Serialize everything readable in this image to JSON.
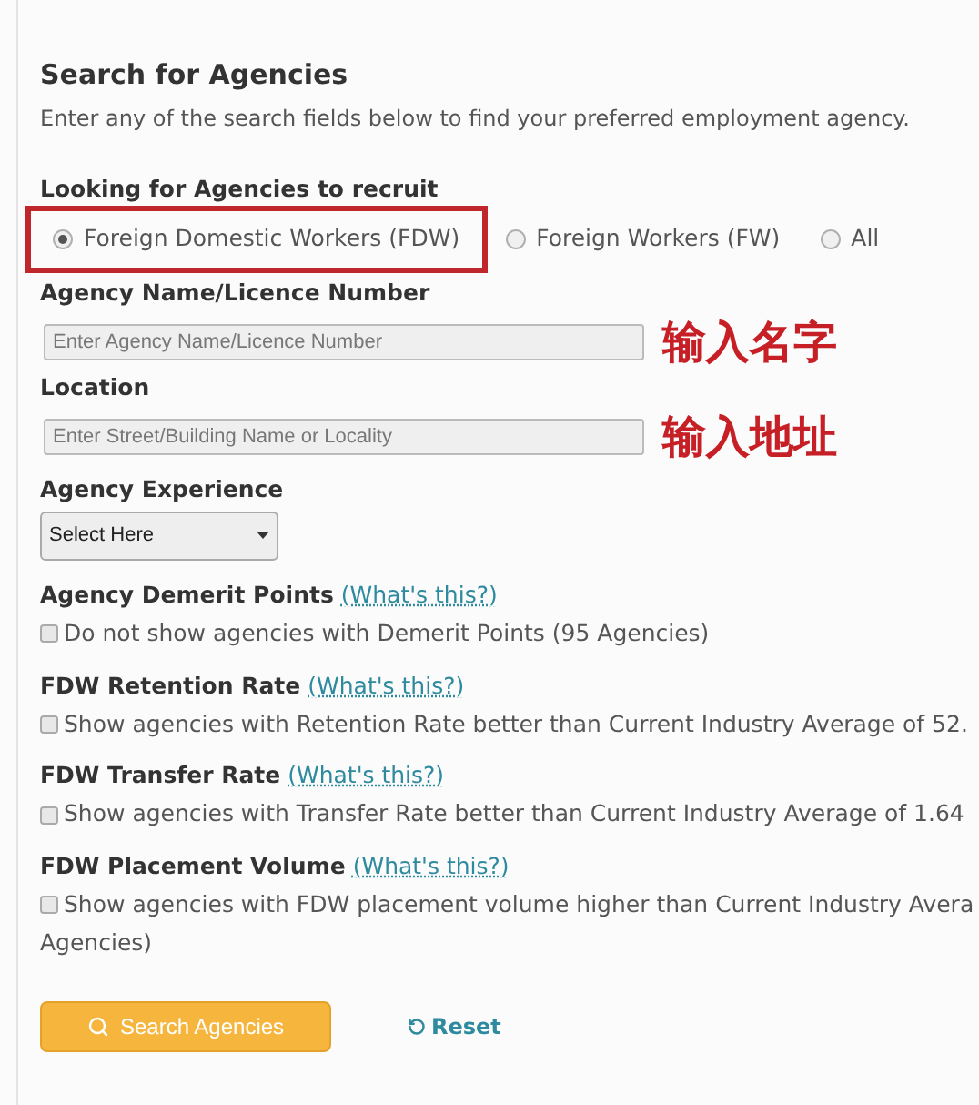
{
  "heading": "Search for Agencies",
  "intro": "Enter any of the search fields below to find your preferred employment agency.",
  "recruit": {
    "label": "Looking for Agencies to recruit",
    "options": [
      {
        "label": "Foreign Domestic Workers (FDW)",
        "selected": true,
        "highlighted": true
      },
      {
        "label": "Foreign Workers (FW)",
        "selected": false,
        "highlighted": false
      },
      {
        "label": "All",
        "selected": false,
        "highlighted": false
      }
    ]
  },
  "fields": [
    {
      "label": "Agency Name/Licence Number",
      "placeholder": "Enter Agency Name/Licence Number",
      "annotation": "输入名字"
    },
    {
      "label": "Location",
      "placeholder": "Enter Street/Building Name or Locality",
      "annotation": "输入地址"
    }
  ],
  "experience": {
    "label": "Agency Experience",
    "value": "Select Here"
  },
  "filters": [
    {
      "title": "Agency Demerit Points",
      "help_link": "(What's this?)",
      "option": "Do not show agencies with Demerit Points (95 Agencies)",
      "checked": false
    },
    {
      "title": "FDW Retention Rate",
      "help_link": "(What's this?)",
      "option": "Show agencies with Retention Rate better than Current Industry Average of 52.",
      "checked": false
    },
    {
      "title": "FDW Transfer Rate",
      "help_link": "(What's this?)",
      "option": "Show agencies with Transfer Rate better than Current Industry Average of 1.64",
      "checked": false
    },
    {
      "title": "FDW Placement Volume",
      "help_link": "(What's this?)",
      "option": "Show agencies with FDW placement volume higher than Current Industry Avera",
      "option_continued": "Agencies)",
      "checked": false
    }
  ],
  "buttons": {
    "search": "Search Agencies",
    "reset": "Reset"
  }
}
